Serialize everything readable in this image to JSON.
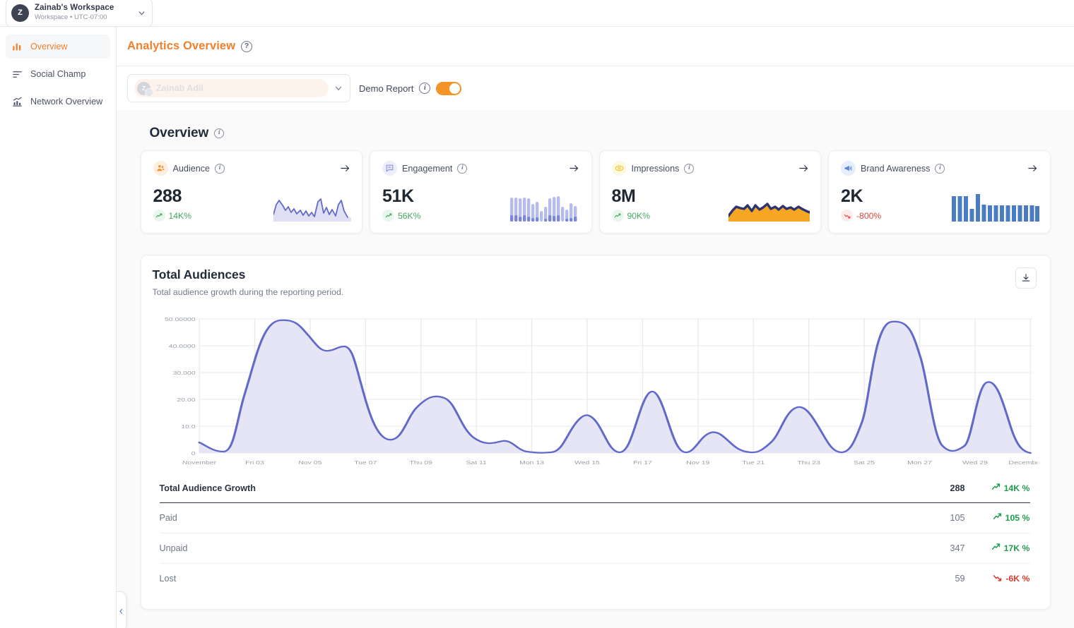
{
  "workspace": {
    "avatar_initial": "Z",
    "name": "Zainab's Workspace",
    "subtitle": "Workspace • UTC-07:00",
    "chevron_icon": "chevron-down-icon"
  },
  "sidebar": {
    "items": [
      {
        "label": "Overview",
        "icon": "bar-chart-icon",
        "active": true
      },
      {
        "label": "Social Champ",
        "icon": "lines-list-icon",
        "active": false
      },
      {
        "label": "Network Overview",
        "icon": "bar-chart-trend-icon",
        "active": false
      }
    ],
    "collapse_icon": "chevron-left-icon"
  },
  "header": {
    "title": "Analytics Overview",
    "help_icon": "question-mark-icon",
    "help_glyph": "?"
  },
  "filters": {
    "account_select": {
      "selected_label": "Zainab Adil",
      "avatar_initial": "Z",
      "chevron_icon": "chevron-down-icon"
    },
    "demo_report": {
      "label": "Demo Report",
      "info_icon": "info-icon",
      "info_glyph": "i",
      "toggle_on": true,
      "accent_color": "#f59426"
    }
  },
  "overview": {
    "title": "Overview",
    "info_glyph": "i",
    "cards": [
      {
        "label": "Audience",
        "icon": "people-group-icon",
        "icon_color": "#f2902e",
        "icon_bg": "#fdeedd",
        "value": "288",
        "delta": "14K%",
        "delta_direction": "up",
        "delta_icon": "trend-up-icon",
        "spark_type": "area-line",
        "spark_color": "#6169c9",
        "spark_values": [
          12,
          30,
          44,
          36,
          25,
          30,
          20,
          26,
          18,
          24,
          14,
          20,
          13,
          17,
          11,
          34,
          40,
          18,
          26,
          16,
          22,
          13,
          30,
          38,
          20,
          12
        ]
      },
      {
        "label": "Engagement",
        "icon": "chat-bars-icon",
        "icon_color": "#7f86d6",
        "icon_bg": "#eceefb",
        "value": "51K",
        "delta": "56K%",
        "delta_direction": "up",
        "delta_icon": "trend-up-icon",
        "spark_type": "bar",
        "spark_color": "#9ba4e0",
        "spark_values": [
          34,
          34,
          33,
          34,
          33,
          25,
          28,
          15,
          21,
          33,
          35,
          36,
          21,
          17,
          26,
          22,
          31
        ]
      },
      {
        "label": "Impressions",
        "icon": "eye-icon",
        "icon_color": "#f0c419",
        "icon_bg": "#fdf8df",
        "value": "8M",
        "delta": "90K%",
        "delta_direction": "up",
        "delta_icon": "trend-up-icon",
        "spark_type": "dual-line",
        "spark_color": "#2b3470",
        "spark_color_2": "#f5a623",
        "spark_values": [
          5,
          11,
          14,
          13,
          12,
          15,
          10,
          15,
          11,
          13,
          17,
          12,
          14,
          11,
          14,
          12,
          13,
          11,
          14,
          12,
          10,
          9
        ],
        "spark_values_2": [
          2,
          5,
          7,
          6,
          6,
          8,
          5,
          8,
          5,
          7,
          9,
          6,
          7,
          5,
          8,
          6,
          7,
          5,
          7,
          6,
          5,
          4
        ]
      },
      {
        "label": "Brand Awareness",
        "icon": "megaphone-icon",
        "icon_color": "#5b86d1",
        "icon_bg": "#e7eefb",
        "value": "2K",
        "delta": "-800%",
        "delta_direction": "down",
        "delta_icon": "trend-down-icon",
        "spark_type": "bar",
        "spark_color": "#4a7cc4",
        "spark_values": [
          33,
          33,
          33,
          18,
          36,
          22,
          21,
          21,
          21,
          21,
          21,
          21,
          21,
          21,
          20
        ]
      }
    ]
  },
  "total_audiences": {
    "title": "Total Audiences",
    "subtitle": "Total audience growth during the reporting period.",
    "download_icon": "download-icon",
    "table": {
      "rows": [
        {
          "label": "Total Audience Growth",
          "value": "288",
          "pct": "14K %",
          "direction": "up",
          "is_header": true
        },
        {
          "label": "Paid",
          "value": "105",
          "pct": "105 %",
          "direction": "up",
          "is_header": false
        },
        {
          "label": "Unpaid",
          "value": "347",
          "pct": "17K %",
          "direction": "up",
          "is_header": false
        },
        {
          "label": "Lost",
          "value": "59",
          "pct": "-6K %",
          "direction": "down",
          "is_header": false
        }
      ]
    }
  },
  "chart_data": {
    "type": "area",
    "title": "Total Audiences",
    "subtitle": "Total audience growth during the reporting period.",
    "xlabel": "",
    "ylabel": "",
    "ylim": [
      0,
      50
    ],
    "grid": true,
    "legend": "none",
    "line_color": "#6169c9",
    "fill_color": "#e7e6f6",
    "ytick_labels": [
      "50.00000",
      "40.0000",
      "30.000",
      "20.00",
      "10.0",
      "0"
    ],
    "ytick_values": [
      50,
      40,
      30,
      20,
      10,
      0
    ],
    "categories": [
      "November",
      "Fri 03",
      "Nov 05",
      "Tue 07",
      "Thu 09",
      "Sat 11",
      "Mon 13",
      "Wed 15",
      "Fri 17",
      "Nov 19",
      "Tue 21",
      "Thu 23",
      "Sat 25",
      "Mon 27",
      "Wed 29",
      "December"
    ],
    "x": [
      0,
      0.5,
      1,
      1.5,
      2,
      2.5,
      3,
      3.5,
      4,
      4.5,
      5,
      5.5,
      6,
      6.5,
      7,
      7.5,
      8,
      8.5,
      9,
      9.5,
      10,
      10.5,
      11,
      11.5,
      12,
      12.5,
      13,
      13.5,
      14,
      14.5,
      15
    ],
    "values": [
      4,
      1,
      1,
      38,
      50,
      48,
      38,
      40,
      15,
      4,
      7,
      26,
      20,
      6,
      5,
      1,
      0,
      1,
      18,
      5,
      30,
      1,
      13,
      2,
      2,
      17,
      6,
      0,
      50,
      48,
      1,
      30,
      1
    ]
  }
}
